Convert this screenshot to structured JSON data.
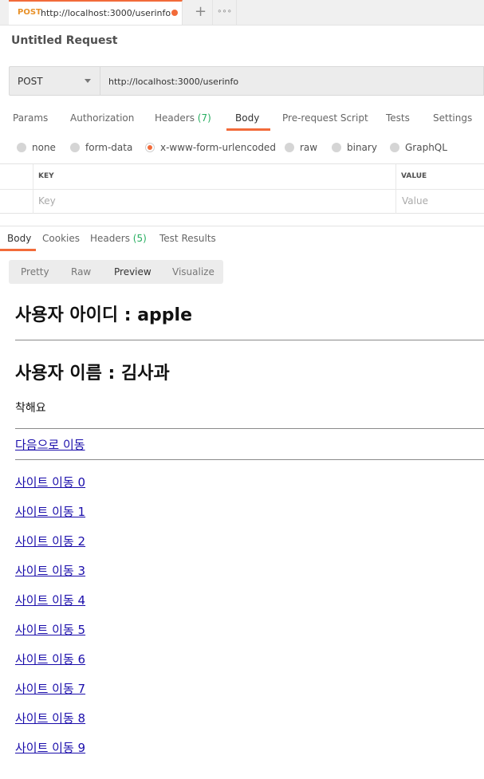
{
  "request_tab": {
    "method": "POST",
    "url": "http://localhost:3000/userinfo"
  },
  "tab_buttons": {
    "add": "+",
    "more": "∘∘∘"
  },
  "request_title": "Untitled Request",
  "url_bar": {
    "method": "POST",
    "url": "http://localhost:3000/userinfo"
  },
  "request_tabs": {
    "params": "Params",
    "authorization": "Authorization",
    "headers": "Headers",
    "headers_count": "(7)",
    "body": "Body",
    "pre_request": "Pre-request Script",
    "tests": "Tests",
    "settings": "Settings"
  },
  "body_types": [
    "none",
    "form-data",
    "x-www-form-urlencoded",
    "raw",
    "binary",
    "GraphQL"
  ],
  "body_type_selected": "x-www-form-urlencoded",
  "kv_table": {
    "key_header": "KEY",
    "value_header": "VALUE",
    "key_placeholder": "Key",
    "value_placeholder": "Value"
  },
  "response_tabs": {
    "body": "Body",
    "cookies": "Cookies",
    "headers": "Headers",
    "headers_count": "(5)",
    "test_results": "Test Results"
  },
  "view_modes": {
    "pretty": "Pretty",
    "raw": "Raw",
    "preview": "Preview",
    "visualize": "Visualize",
    "active": "Preview"
  },
  "preview": {
    "user_id_heading": "사용자 아이디 : apple",
    "user_name_heading": "사용자 이름 : 김사과",
    "description": "착해요",
    "next_link": "다음으로 이동",
    "site_links": [
      "사이트 이동 0",
      "사이트 이동 1",
      "사이트 이동 2",
      "사이트 이동 3",
      "사이트 이동 4",
      "사이트 이동 5",
      "사이트 이동 6",
      "사이트 이동 7",
      "사이트 이동 8",
      "사이트 이동 9"
    ]
  },
  "colors": {
    "accent": "#f26b3a",
    "count_green": "#27ae60",
    "method_orange": "#e8912a",
    "link": "#1a0dab"
  }
}
